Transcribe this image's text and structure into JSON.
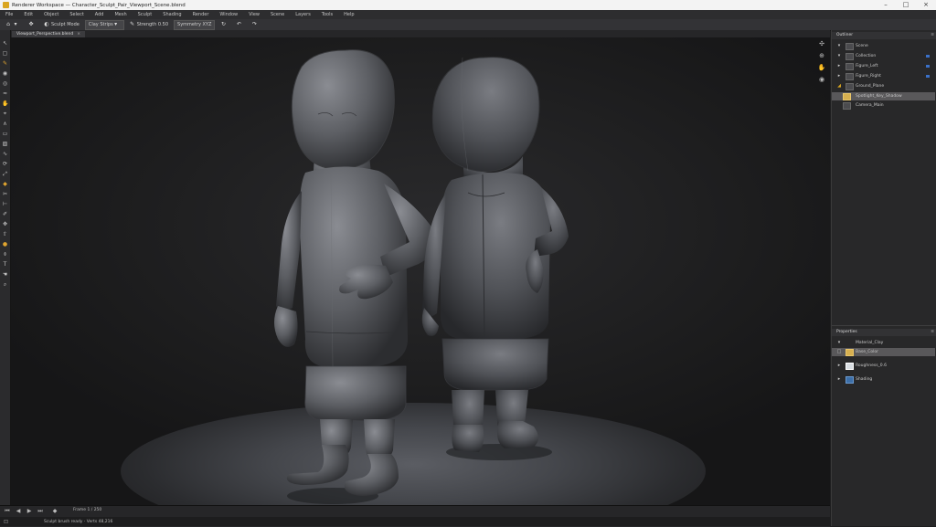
{
  "window": {
    "title": "Renderer Workspace — Character_Sculpt_Pair_Viewport_Scene.blend",
    "controls": {
      "minimize": "–",
      "maximize": "□",
      "close": "×"
    }
  },
  "menubar": {
    "items": [
      "File",
      "Edit",
      "Object",
      "Select",
      "Add",
      "Mesh",
      "Sculpt",
      "Shading",
      "Render",
      "Window",
      "View",
      "Scene",
      "Layers",
      "Tools",
      "Help"
    ]
  },
  "toolbar": {
    "mode": "Sculpt Mode",
    "brush": "Clay Strips",
    "strength": "Strength 0.50",
    "symmetry": "Symmetry XYZ"
  },
  "document_tab": {
    "label": "Viewport_Perspective.blend"
  },
  "right_panel": {
    "outliner": {
      "title": "Outliner",
      "items": [
        {
          "label": "Scene",
          "icon": "scene-icon"
        },
        {
          "label": "Collection",
          "icon": "collection-icon"
        },
        {
          "label": "Figure_Left",
          "icon": "mesh-icon"
        },
        {
          "label": "Figure_Right",
          "icon": "mesh-icon"
        },
        {
          "label": "Ground_Plane",
          "icon": "plane-icon"
        },
        {
          "label": "Spotlight_Key_Shadow",
          "icon": "light-icon"
        },
        {
          "label": "Camera_Main",
          "icon": "camera-icon"
        }
      ]
    },
    "properties": {
      "title": "Properties",
      "items": [
        {
          "label": "Material_Clay"
        },
        {
          "label": "Base_Color"
        },
        {
          "label": "Roughness_0.6"
        },
        {
          "label": "Shading"
        }
      ]
    }
  },
  "bottom": {
    "timeline_label": "Frame 1 / 250",
    "status_text": "Sculpt brush ready · Verts 48,216"
  },
  "colors": {
    "accent": "#d9a520",
    "background": "#1e1e1f",
    "panel": "#282829",
    "selected_row": "#59585a"
  }
}
